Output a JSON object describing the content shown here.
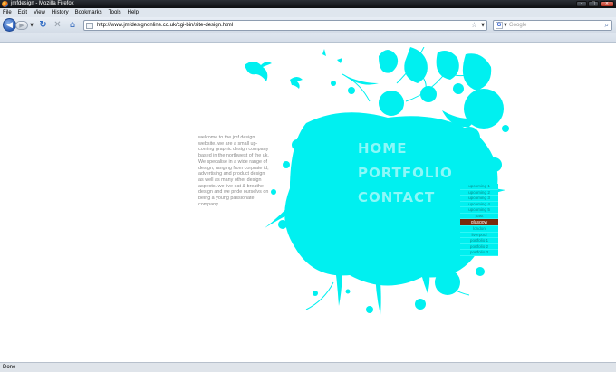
{
  "window": {
    "title": "jmfdesign - Mozilla Firefox"
  },
  "menubar": {
    "items": [
      "File",
      "Edit",
      "View",
      "History",
      "Bookmarks",
      "Tools",
      "Help"
    ]
  },
  "navbar": {
    "url": "http://www.jmfdesignonline.co.uk/cgi-bin/site-design.html",
    "search_placeholder": "Google",
    "search_engine_letter": "G"
  },
  "content": {
    "welcome": "welcome to the jmf design website. we are a small up-coming graphic design company based in the northwest of the uk. We specalise in a wide range of design, ranging from corprate id, advertising and product design as well as many other design aspects. we live eat & breathe design and we pride ourselvs on being a young passionate company.",
    "nav_words": [
      "HOME",
      "PORTFOLIO",
      "CONTACT"
    ],
    "side_list": {
      "items": [
        "upcoming 1",
        "upcoming 2",
        "upcoming 3",
        "upcoming 4",
        "upcoming 5",
        "past",
        "glasgow",
        "london",
        "liverpool",
        "portfolio 1",
        "portfolio 2",
        "portfolio 3"
      ],
      "selected_index": 6
    },
    "splash_color": "#00f0f0",
    "selected_color": "#7a2b0c"
  },
  "status": {
    "text": "Done"
  }
}
